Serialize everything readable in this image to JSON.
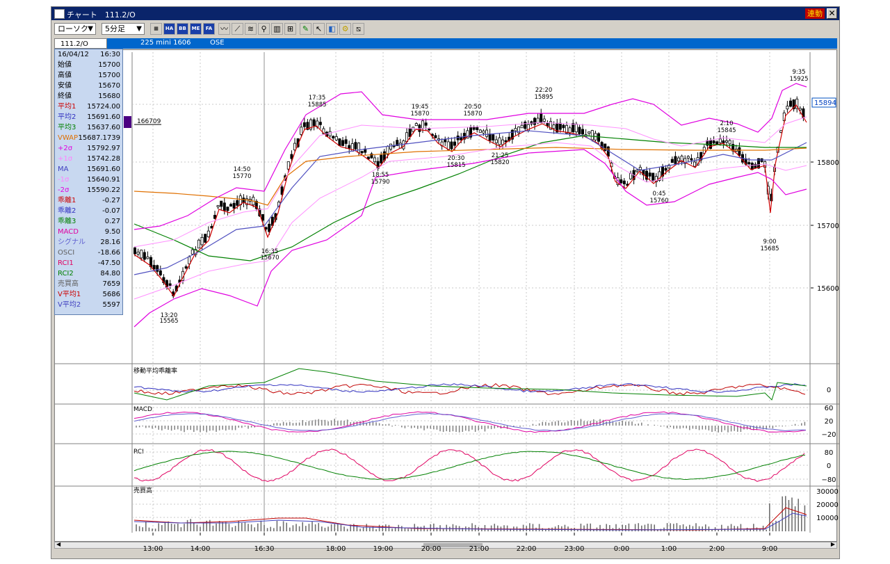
{
  "window": {
    "title": "チャート　111.2/O",
    "sync_label": "連動",
    "close_label": "✕"
  },
  "toolbar": {
    "chart_type": "ローソク",
    "interval": "5分足",
    "buttons": [
      "order-book",
      "HA",
      "BB",
      "ME",
      "FA",
      "line",
      "trend",
      "fibonacci",
      "zoom",
      "indicator",
      "pen",
      "cursor",
      "eraser",
      "settings",
      "draw"
    ]
  },
  "infobar": {
    "symbol": "111.2/O",
    "contract": "225 mini 1606",
    "exchange": "OSE"
  },
  "readout": {
    "date": "16/04/12",
    "time": "16:30",
    "rows": [
      {
        "label": "始値",
        "value": "15700",
        "color": "#000000"
      },
      {
        "label": "高値",
        "value": "15700",
        "color": "#000000"
      },
      {
        "label": "安値",
        "value": "15670",
        "color": "#000000"
      },
      {
        "label": "終値",
        "value": "15680",
        "color": "#000000"
      },
      {
        "label": "平均1",
        "value": "15724.00",
        "color": "#cc0000"
      },
      {
        "label": "平均2",
        "value": "15691.60",
        "color": "#3030c0"
      },
      {
        "label": "平均3",
        "value": "15637.60",
        "color": "#008000"
      },
      {
        "label": "VWAP",
        "value": "15687.1739",
        "color": "#e07000"
      },
      {
        "label": "+2σ",
        "value": "15792.97",
        "color": "#e000e0"
      },
      {
        "label": "+1σ",
        "value": "15742.28",
        "color": "#ff80ff"
      },
      {
        "label": "MA",
        "value": "15691.60",
        "color": "#4040c0"
      },
      {
        "label": "-1σ",
        "value": "15640.91",
        "color": "#ff80ff"
      },
      {
        "label": "-2σ",
        "value": "15590.22",
        "color": "#e000e0"
      },
      {
        "label": "乖離1",
        "value": "-0.27",
        "color": "#cc0000"
      },
      {
        "label": "乖離2",
        "value": "-0.07",
        "color": "#3030c0"
      },
      {
        "label": "乖離3",
        "value": "0.27",
        "color": "#008000"
      },
      {
        "label": "MACD",
        "value": "9.50",
        "color": "#e000a0"
      },
      {
        "label": "シグナル",
        "value": "28.16",
        "color": "#6060d0"
      },
      {
        "label": "OSCI",
        "value": "-18.66",
        "color": "#606060"
      },
      {
        "label": "RCI1",
        "value": "-47.50",
        "color": "#e00060"
      },
      {
        "label": "RCI2",
        "value": "84.80",
        "color": "#008000"
      },
      {
        "label": "売買高",
        "value": "7659",
        "color": "#606060"
      },
      {
        "label": "V平均1",
        "value": "5686",
        "color": "#cc0000"
      },
      {
        "label": "V平均2",
        "value": "5597",
        "color": "#4040c0"
      }
    ]
  },
  "main_chart": {
    "cursor_volume_label": "166709",
    "last_price_label": "15894",
    "price_ticks": [
      "15800",
      "15700",
      "15600"
    ],
    "annotations": [
      {
        "time": "13:20",
        "price": "15565"
      },
      {
        "time": "14:50",
        "price": "15770"
      },
      {
        "time": "16:35",
        "price": "15670"
      },
      {
        "time": "17:35",
        "price": "15885"
      },
      {
        "time": "18:55",
        "price": "15790"
      },
      {
        "time": "19:45",
        "price": "15870"
      },
      {
        "time": "20:30",
        "price": "15815"
      },
      {
        "time": "20:50",
        "price": "15870"
      },
      {
        "time": "21:25",
        "price": "15820"
      },
      {
        "time": "22:20",
        "price": "15895"
      },
      {
        "time": "0:45",
        "price": "15760"
      },
      {
        "time": "2:10",
        "price": "15845"
      },
      {
        "time": "9:00",
        "price": "15685"
      },
      {
        "time": "9:35",
        "price": "15925"
      }
    ]
  },
  "sub_panels": {
    "deviation": {
      "title": "移動平均乖離率",
      "ticks": [
        "0"
      ]
    },
    "macd": {
      "title": "MACD",
      "ticks": [
        "60",
        "20",
        "−20"
      ]
    },
    "rci": {
      "title": "RCI",
      "ticks": [
        "80",
        "0",
        "−80"
      ]
    },
    "volume": {
      "title": "売買高",
      "ticks": [
        "30000",
        "20000",
        "10000"
      ]
    }
  },
  "time_axis": [
    "13:00",
    "14:00",
    "16:30",
    "18:00",
    "19:00",
    "20:00",
    "21:00",
    "22:00",
    "23:00",
    "0:00",
    "1:00",
    "2:00",
    "9:00"
  ]
}
